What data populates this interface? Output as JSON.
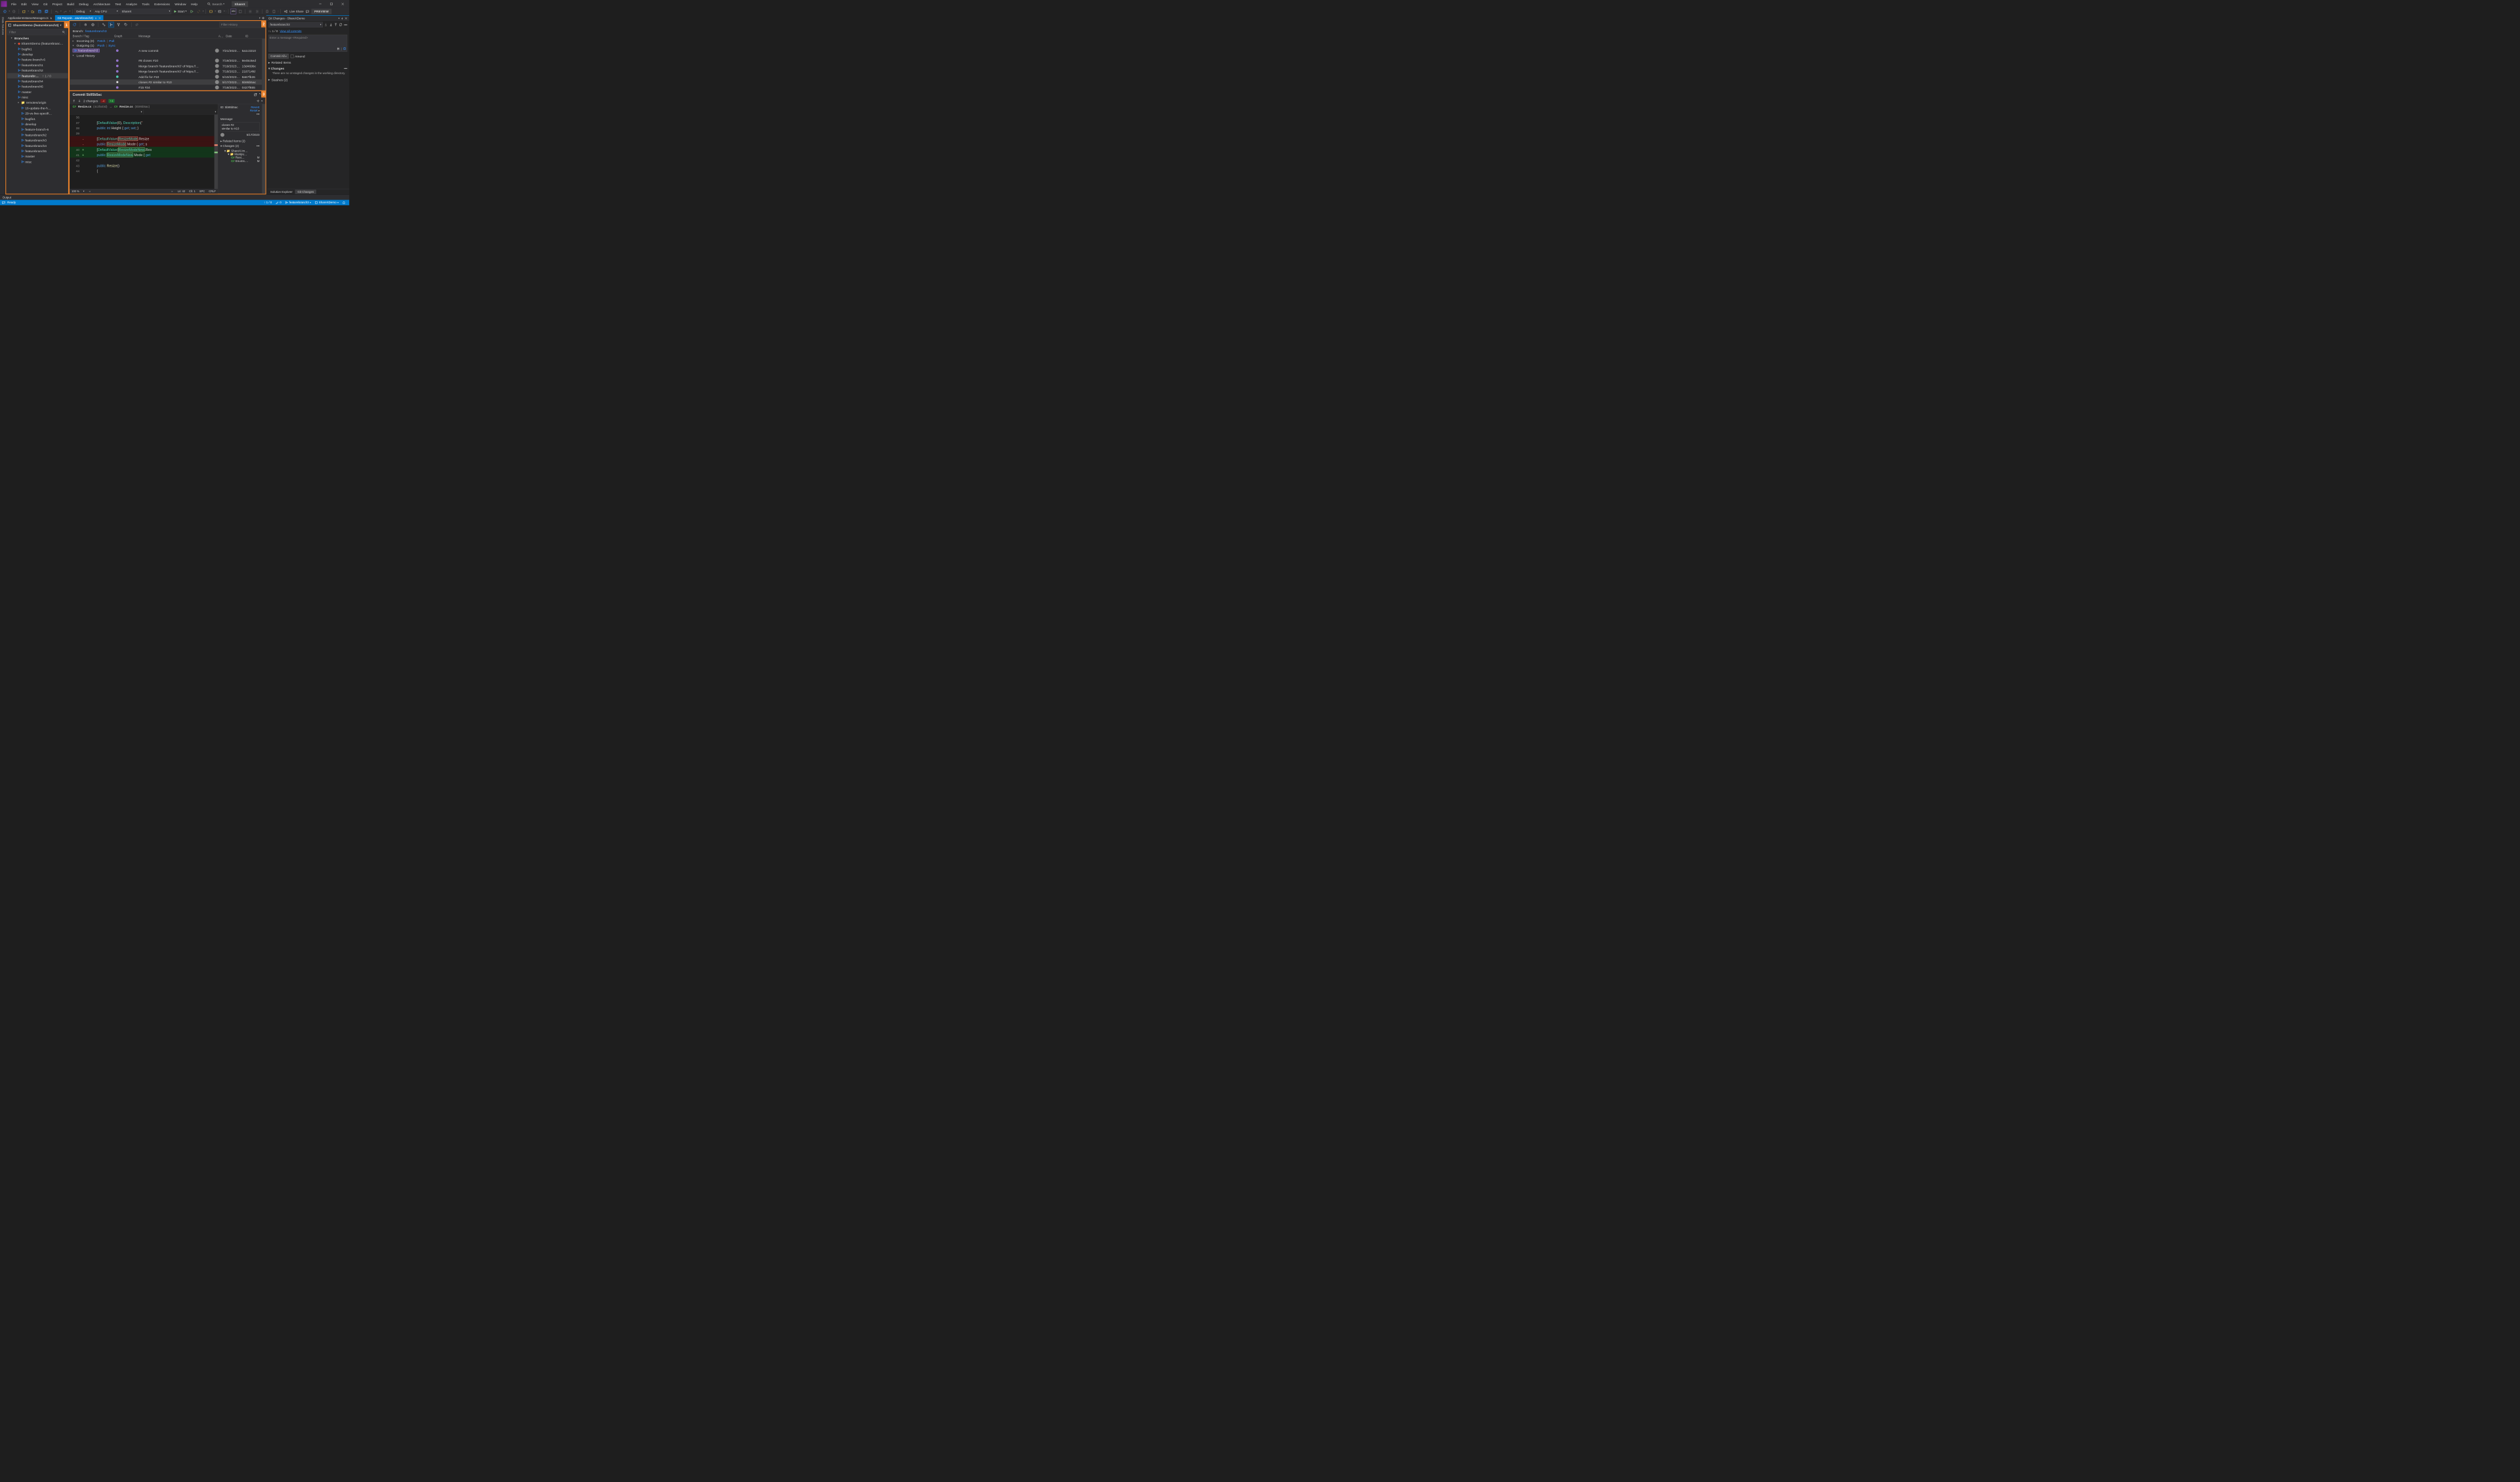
{
  "menu": [
    "File",
    "Edit",
    "View",
    "Git",
    "Project",
    "Build",
    "Debug",
    "Architecture",
    "Test",
    "Analyze",
    "Tools",
    "Extensions",
    "Window",
    "Help"
  ],
  "title_search": "Search",
  "solution": "ShareX",
  "toolbar": {
    "config": "Debug",
    "platform": "Any CPU",
    "startup": "ShareX",
    "start": "Start",
    "live_share": "Live Share",
    "preview": "PREVIEW"
  },
  "data_sources_label": "Data Sources",
  "doc_tabs": {
    "pinned": "ApplicationInstanceManager.cs",
    "active": "Git Reposit…aturebranch3)"
  },
  "repo": {
    "header": "ShareXDemo (featurebranch3)",
    "filter_placeholder": "Filter",
    "branches_label": "Branches",
    "root": "ShareXDemo (featurebranc…",
    "local": [
      "bugfix1",
      "develop",
      "feature-branch-6",
      "featurebranch1",
      "featurebranch2",
      "featurebr…",
      "featurebranch4",
      "featurebranch5",
      "master",
      "misc"
    ],
    "active_branch_counts": "↑ 1 / 0",
    "remotes_label": "remotes/origin",
    "remotes": [
      "16-update-the-h…",
      "29-vs-live-specifi…",
      "bugfix1",
      "develop",
      "feature-branch-6",
      "featurebranch2",
      "featurebranch3",
      "featurebranch4",
      "featurebranch5",
      "master",
      "misc"
    ]
  },
  "history": {
    "filter_placeholder": "Filter History",
    "branch_label": "Branch:",
    "branch_name": "featurebranch3",
    "cols": {
      "branch": "Branch / Tag",
      "graph": "Graph",
      "msg": "Message",
      "auth": "A…",
      "date": "Date",
      "id": "ID"
    },
    "incoming": "Incoming (0)",
    "fetch": "Fetch",
    "pull": "Pull",
    "outgoing": "Outgoing (1)",
    "push": "Push",
    "sync": "Sync",
    "out_commit": {
      "branch": "featurebranch3",
      "msg": "A new commit",
      "date": "7/21/2023…",
      "id": "5a1c3210"
    },
    "local_history": "Local History",
    "rows": [
      {
        "msg": "#8 closes #10",
        "date": "7/19/2023…",
        "id": "9e45c6ed"
      },
      {
        "msg": "Merge branch 'featurebranch3' of https://…",
        "date": "7/19/2023…",
        "id": "13d469bc"
      },
      {
        "msg": "Merge branch 'featurebranch3' of https://…",
        "date": "7/18/2023…",
        "id": "218714fd"
      },
      {
        "msg": "Add fix for #10",
        "date": "5/10/2023…",
        "id": "8a57fb26"
      },
      {
        "msg": "closes #2 similar to #10",
        "date": "5/17/2023…",
        "id": "5b95b5ac"
      },
      {
        "msg": "#15 #34",
        "date": "7/18/2023…",
        "id": "0427f655"
      }
    ]
  },
  "diff": {
    "commit_title": "Commit 5b95b5ac",
    "changes_label": "2 changes",
    "neg": "-4",
    "pos": "+4",
    "file_left": "Resize.cs",
    "file_left_hash": "(4c2fa03d)",
    "file_right": "Resize.cs",
    "file_right_hash": "(5b95b5ac)",
    "revert": "Revert",
    "reset": "Reset",
    "id_label": "ID:",
    "id": "5b95b5ac",
    "msg_label": "Message:",
    "msg_lines": [
      "closes #2",
      "similar to #10"
    ],
    "commit_date": "5/17/2023",
    "related": "Related Items (2)",
    "changes_hdr": "Changes (2)",
    "files": [
      "ShareX.Im…",
      "Manipu…",
      "Resi…",
      "Enums.…"
    ],
    "mod_mark": "M",
    "zoom": "100 %",
    "ln": "Ln: 42",
    "ch": "Ch: 1",
    "spc": "SPC",
    "crlf": "CRLF"
  },
  "git_changes": {
    "title": "Git Changes - ShareXDemo",
    "branch": "featurebranch3",
    "counts": "↑↓ 1 / 0",
    "view_all": "View all commits",
    "placeholder": "Enter a message <Required>",
    "commit_all": "Commit All",
    "amend": "Amend",
    "related": "Related Items",
    "changes": "Changes",
    "no_changes": "There are no unstaged changes in the working directory.",
    "stashes": "Stashes (2)",
    "bottom_tabs": [
      "Solution Explorer",
      "Git Changes"
    ]
  },
  "output_label": "Output",
  "status": {
    "ready": "Ready",
    "up_down": "↑ 1 / 0",
    "pencil": "0",
    "branch": "featurebranch3",
    "solution": "ShareXDemo"
  }
}
